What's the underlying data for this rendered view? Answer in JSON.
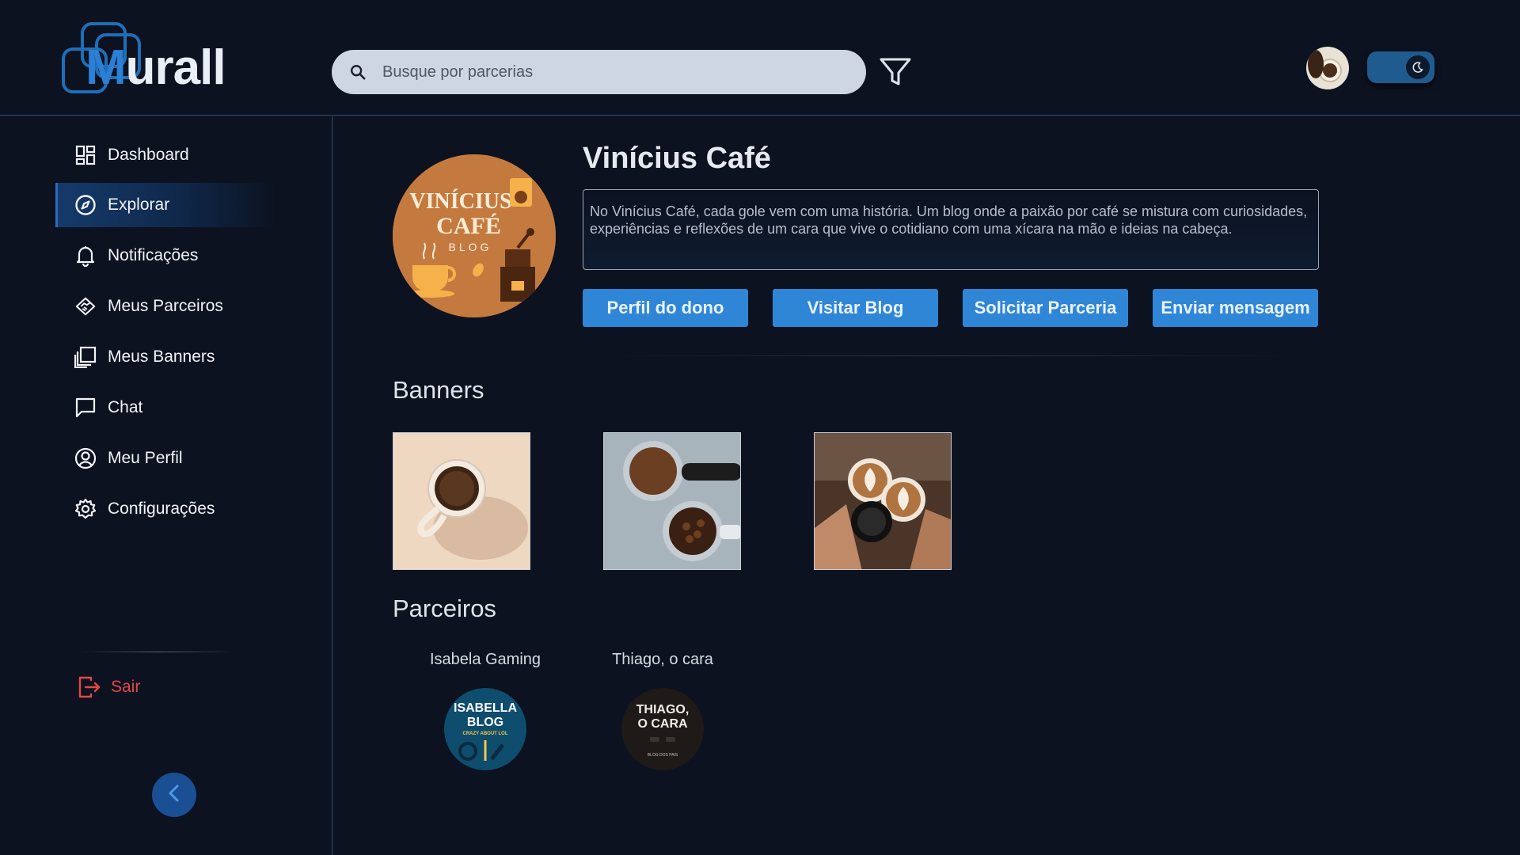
{
  "header": {
    "logo_text_prefix": "M",
    "logo_text_suffix": "urall",
    "search": {
      "placeholder": "Busque por parcerias",
      "value": ""
    }
  },
  "sidebar": {
    "items": [
      {
        "label": "Dashboard",
        "icon": "dashboard-icon"
      },
      {
        "label": "Explorar",
        "icon": "compass-icon",
        "active": true
      },
      {
        "label": "Notificações",
        "icon": "bell-icon"
      },
      {
        "label": "Meus Parceiros",
        "icon": "handshake-icon"
      },
      {
        "label": "Meus Banners",
        "icon": "banners-icon"
      },
      {
        "label": "Chat",
        "icon": "chat-icon"
      },
      {
        "label": "Meu Perfil",
        "icon": "user-circle-icon"
      },
      {
        "label": "Configurações",
        "icon": "gear-icon"
      }
    ],
    "logout_label": "Sair"
  },
  "profile": {
    "name": "Vinícius Café",
    "logo_line1": "VINÍCIUS",
    "logo_line2": "CAFÉ",
    "logo_line3": "BLOG",
    "description": "No Vinícius Café, cada gole vem com uma história. Um blog onde a paixão por café se mistura com curiosidades, experiências e reflexões de um cara que vive o cotidiano com uma xícara na mão e ideias na cabeça.",
    "buttons": {
      "owner_profile": "Perfil do dono",
      "visit_blog": "Visitar Blog",
      "request_partnership": "Solicitar Parceria",
      "send_message": "Enviar mensagem"
    }
  },
  "banners": {
    "title": "Banners",
    "items": [
      "coffee-mug-photo",
      "coffee-grounds-photo",
      "latte-toast-photo"
    ]
  },
  "partners": {
    "title": "Parceiros",
    "items": [
      {
        "name": "Isabela Gaming",
        "logo_line1": "ISABELLA",
        "logo_line2": "BLOG",
        "logo_line3": "CRAZY ABOUT LOL"
      },
      {
        "name": "Thiago, o cara",
        "logo_line1": "THIAGO,",
        "logo_line2": "O CARA",
        "logo_line3": "BLOG DOS PAIS"
      }
    ]
  },
  "colors": {
    "background": "#0c1220",
    "accent": "#2f86d6",
    "danger": "#e84545",
    "border": "#2a4f7a"
  }
}
